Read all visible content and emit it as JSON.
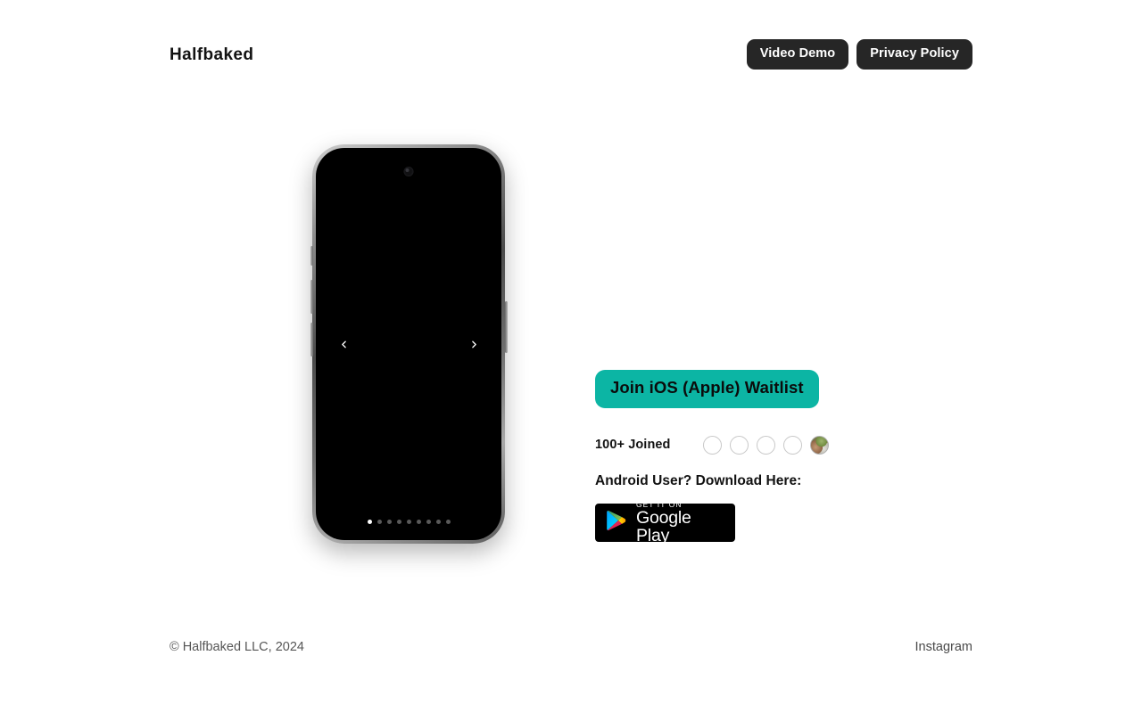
{
  "header": {
    "brand": "Halfbaked",
    "buttons": [
      {
        "label": "Video Demo",
        "name": "video-demo-button"
      },
      {
        "label": "Privacy Policy",
        "name": "privacy-policy-button"
      }
    ]
  },
  "hero": {
    "phone": {
      "carousel": {
        "prev_label": "Previous screenshot",
        "next_label": "Next screenshot",
        "total_dots": 9,
        "active_dot": 1
      }
    },
    "cta": {
      "waitlist_label": "Join iOS (Apple) Waitlist",
      "waitlist_color": "#0cb5a4",
      "joined_count": "100+ Joined",
      "avatars": [
        {
          "type": "placeholder"
        },
        {
          "type": "placeholder"
        },
        {
          "type": "placeholder"
        },
        {
          "type": "placeholder"
        },
        {
          "type": "photo"
        }
      ],
      "android_label": "Android User? Download Here:",
      "google_play": {
        "small_text": "GET IT ON",
        "big_text": "Google Play"
      }
    }
  },
  "footer": {
    "copyright": "© Halfbaked LLC, 2024",
    "link": "Instagram"
  },
  "colors": {
    "page_background": "#ffffff",
    "button_dark": "#262626",
    "accent_teal": "#0cb5a4",
    "text_primary": "#121212",
    "text_muted": "#565656",
    "phone_screen": "#000000"
  }
}
